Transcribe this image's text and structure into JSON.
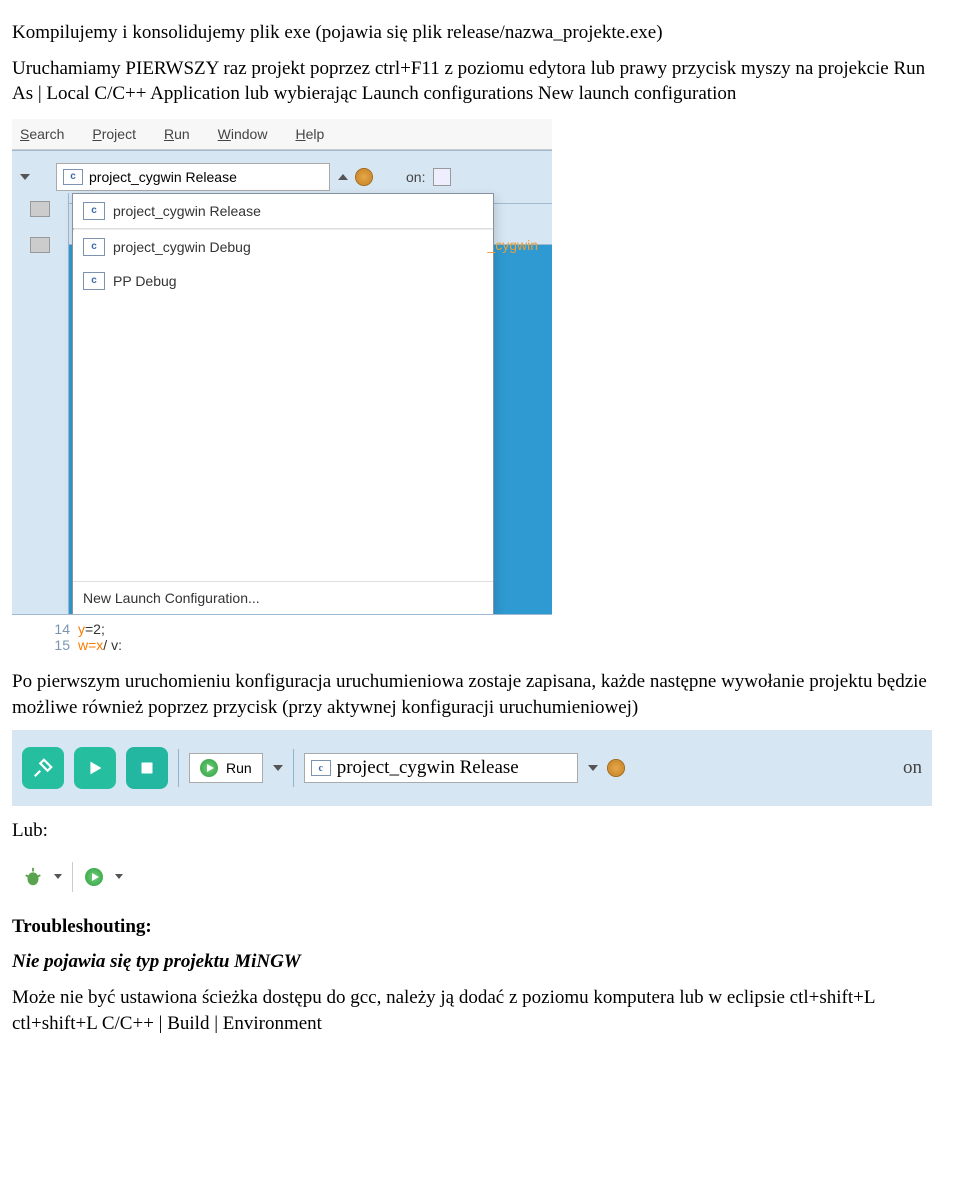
{
  "para1": "Kompilujemy i konsolidujemy plik exe (pojawia się plik release/nazwa_projekte.exe)",
  "para2": "Uruchamiamy PIERWSZY raz projekt poprzez ctrl+F11 z poziomu edytora lub prawy przycisk myszy na projekcie Run As | Local C/C++ Application lub wybierając Launch configurations New launch configuration",
  "shot1": {
    "menu": {
      "m0": "Search",
      "m1": "Project",
      "m2": "Run",
      "m3": "Window",
      "m4": "Help"
    },
    "combo_main": "project_cygwin Release",
    "on_label": "on:",
    "txt_label": "_cygwin",
    "dropdown": {
      "i0": "project_cygwin Release",
      "i1": "project_cygwin Debug",
      "i2": "PP Debug",
      "footer": "New Launch Configuration..."
    },
    "editor": {
      "ln14": "14",
      "ln15": "15",
      "code14_l": "y",
      "code14_r": "=2;",
      "code15_l": "w=x",
      "code15_r": " / v:"
    }
  },
  "para3": "Po pierwszym uruchomieniu konfiguracja uruchumieniowa zostaje zapisana, każde następne wywołanie projektu będzie możliwe również poprzez przycisk (przy aktywnej konfiguracji uruchumieniowej)",
  "shot2": {
    "run_label": "Run",
    "combo_label": "project_cygwin Release",
    "on_label": "on"
  },
  "lub_label": "Lub:",
  "troubleshooting_heading": "Troubleshouting:",
  "trouble_line1": "Nie pojawia się typ projektu MiNGW",
  "trouble_line2": "Może nie być ustawiona ścieżka dostępu do gcc, należy ją dodać z poziomu komputera lub w eclipsie ctl+shift+L ctl+shift+L C/C++ | Build | Environment"
}
